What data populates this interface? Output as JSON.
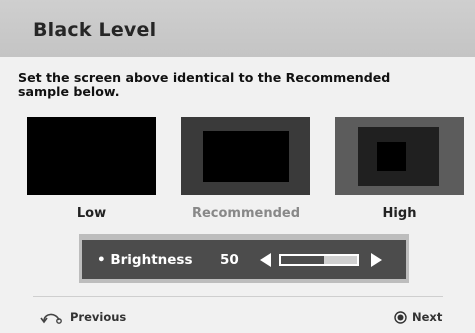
{
  "header": {
    "title": "Black Level"
  },
  "instruction": {
    "line1": "Set the screen above identical to the Recommended",
    "line2": "sample  below."
  },
  "samples": [
    {
      "label": "Low"
    },
    {
      "label": "Recommended"
    },
    {
      "label": "High"
    }
  ],
  "control": {
    "bullet": "•",
    "label": "Brightness",
    "value": "50",
    "slider_fraction": 0.56
  },
  "footer": {
    "previous": "Previous",
    "next": "Next"
  },
  "colors": {
    "header_bg": "#c8c8c8",
    "panel_bg": "#4c4c4c",
    "disabled_label": "#888888"
  },
  "icons": [
    "return-arrow-icon",
    "circle-button-icon",
    "left-arrow-icon",
    "right-arrow-icon"
  ]
}
